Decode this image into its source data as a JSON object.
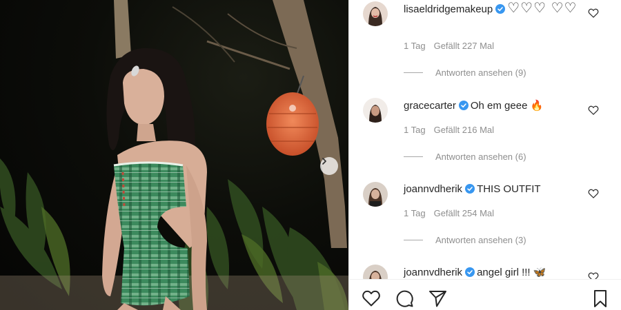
{
  "media": {
    "next_icon": "chevron-right-icon"
  },
  "comments": [
    {
      "username": "lisaeldridgemakeup",
      "verified": true,
      "text": "♡♡♡ ♡♡",
      "age": "1 Tag",
      "likes": "Gefällt 227 Mal",
      "replies": "Antworten ansehen (9)"
    },
    {
      "username": "gracecarter",
      "verified": true,
      "text": "Oh em geee 🔥",
      "age": "1 Tag",
      "likes": "Gefällt 216 Mal",
      "replies": "Antworten ansehen (6)"
    },
    {
      "username": "joannvdherik",
      "verified": true,
      "text": "THIS OUTFIT",
      "age": "1 Tag",
      "likes": "Gefällt 254 Mal",
      "replies": "Antworten ansehen (3)"
    },
    {
      "username": "joannvdherik",
      "verified": true,
      "text": "angel girl !!! 🦋",
      "age": "",
      "likes": "",
      "replies": ""
    }
  ],
  "actions": {
    "like_icon": "heart-icon",
    "comment_icon": "comment-bubble-icon",
    "share_icon": "paper-plane-icon",
    "save_icon": "bookmark-icon"
  },
  "colors": {
    "verified": "#3897f0",
    "text": "#262626",
    "meta": "#8e8e8e"
  }
}
